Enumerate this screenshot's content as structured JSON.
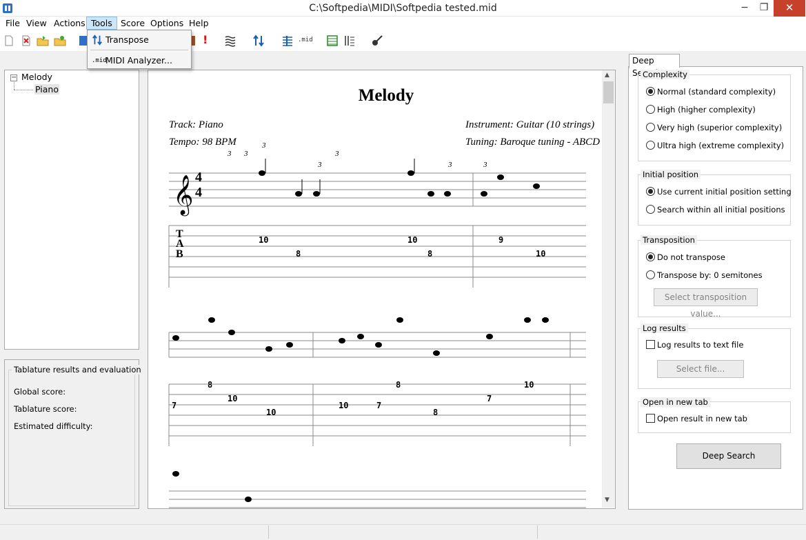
{
  "window": {
    "title": "C:\\Softpedia\\MIDI\\Softpedia tested.mid",
    "minimize": "−",
    "maximize": "❐",
    "close": "✕"
  },
  "menu": {
    "file": "File",
    "view": "View",
    "actions": "Actions",
    "tools": "Tools",
    "score": "Score",
    "options": "Options",
    "help": "Help"
  },
  "tools_menu": {
    "transpose": "Transpose",
    "midi_analyzer": "MIDI Analyzer...",
    "midi_badge": ".mid"
  },
  "toolbar": {
    "midi_badge": ".mid",
    "alert": "!"
  },
  "tree": {
    "root": "Melody",
    "child": "Piano",
    "expander": "−"
  },
  "evaluation": {
    "title": "Tablature results and evaluation",
    "global_score": "Global score:",
    "tablature_score": "Tablature score:",
    "estimated_difficulty": "Estimated difficulty:"
  },
  "score": {
    "title": "Melody",
    "track": "Track: Piano",
    "tempo": "Tempo: 98 BPM",
    "instrument": "Instrument: Guitar (10 strings)",
    "tuning": "Tuning: Baroque tuning - ABCD",
    "time_sig_top": "4",
    "time_sig_bottom": "4",
    "tab_t": "T",
    "tab_a": "A",
    "tab_b": "B",
    "triplet": "3",
    "system1_frets": [
      "10",
      "8",
      "10",
      "8",
      "9",
      "10"
    ],
    "system2_frets": [
      "8",
      "7",
      "10",
      "10",
      "10",
      "7",
      "8",
      "8",
      "7",
      "10"
    ]
  },
  "deep_search": {
    "tab": "Deep Search",
    "complexity": {
      "title": "Complexity",
      "options": [
        "Normal (standard complexity)",
        "High (higher complexity)",
        "Very high (superior complexity)",
        "Ultra high (extreme complexity)"
      ],
      "selected": 0
    },
    "initial_position": {
      "title": "Initial position",
      "options": [
        "Use current initial position setting",
        "Search within all initial positions"
      ],
      "selected": 0
    },
    "transposition": {
      "title": "Transposition",
      "options": [
        "Do not transpose",
        "Transpose by: 0 semitones"
      ],
      "selected": 0,
      "select_button": "Select transposition value..."
    },
    "log_results": {
      "title": "Log results",
      "checkbox": "Log results to text file",
      "select_button": "Select file..."
    },
    "open_new_tab": {
      "title": "Open in new tab",
      "checkbox": "Open result in new tab"
    },
    "button": "Deep Search"
  }
}
